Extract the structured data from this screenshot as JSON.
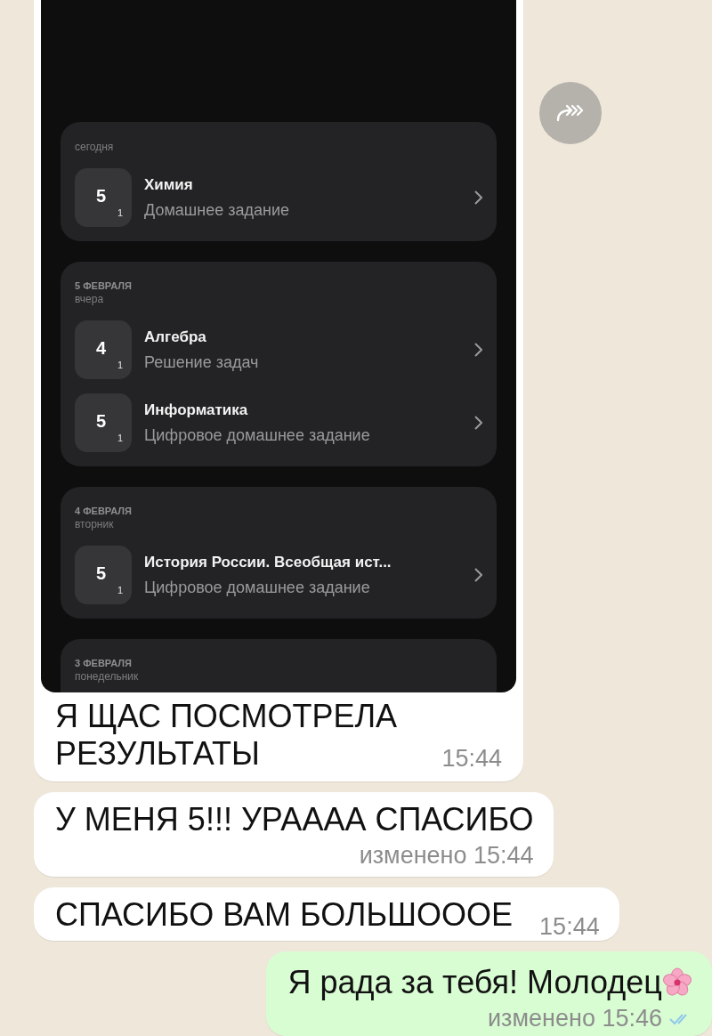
{
  "chat": {
    "messages": [
      {
        "kind": "image",
        "outgoing": false,
        "screenshot": {
          "groups": [
            {
              "subtitle": "сегодня",
              "items": [
                {
                  "grade": "5",
                  "weight": "1",
                  "subject": "Химия",
                  "work": "Домашнее задание"
                }
              ]
            },
            {
              "date": "5 ФЕВРАЛЯ",
              "subtitle": "вчера",
              "items": [
                {
                  "grade": "4",
                  "weight": "1",
                  "subject": "Алгебра",
                  "work": "Решение задач"
                },
                {
                  "grade": "5",
                  "weight": "1",
                  "subject": "Информатика",
                  "work": "Цифровое домашнее задание"
                }
              ]
            },
            {
              "date": "4 ФЕВРАЛЯ",
              "subtitle": "вторник",
              "items": [
                {
                  "grade": "5",
                  "weight": "1",
                  "subject": "История России. Всеобщая ист...",
                  "work": "Цифровое домашнее задание"
                }
              ]
            },
            {
              "date": "3 ФЕВРАЛЯ",
              "subtitle": "понедельник"
            }
          ]
        },
        "text": "Я ЩАС ПОСМОТРЕЛА РЕЗУЛЬТАТЫ",
        "time": "15:44"
      },
      {
        "kind": "text",
        "outgoing": false,
        "text": "У МЕНЯ 5!!! УРАААА СПАСИБО",
        "time": "изменено 15:44",
        "meta_below": true
      },
      {
        "kind": "text",
        "outgoing": false,
        "text": "СПАСИБО ВАМ БОЛЬШОООЕ",
        "time": "15:44",
        "meta_below": false
      },
      {
        "kind": "text",
        "outgoing": true,
        "text": "Я рада за тебя! Молодец",
        "emoji": true,
        "time": "изменено 15:46",
        "meta_below": true,
        "read": true
      }
    ]
  }
}
